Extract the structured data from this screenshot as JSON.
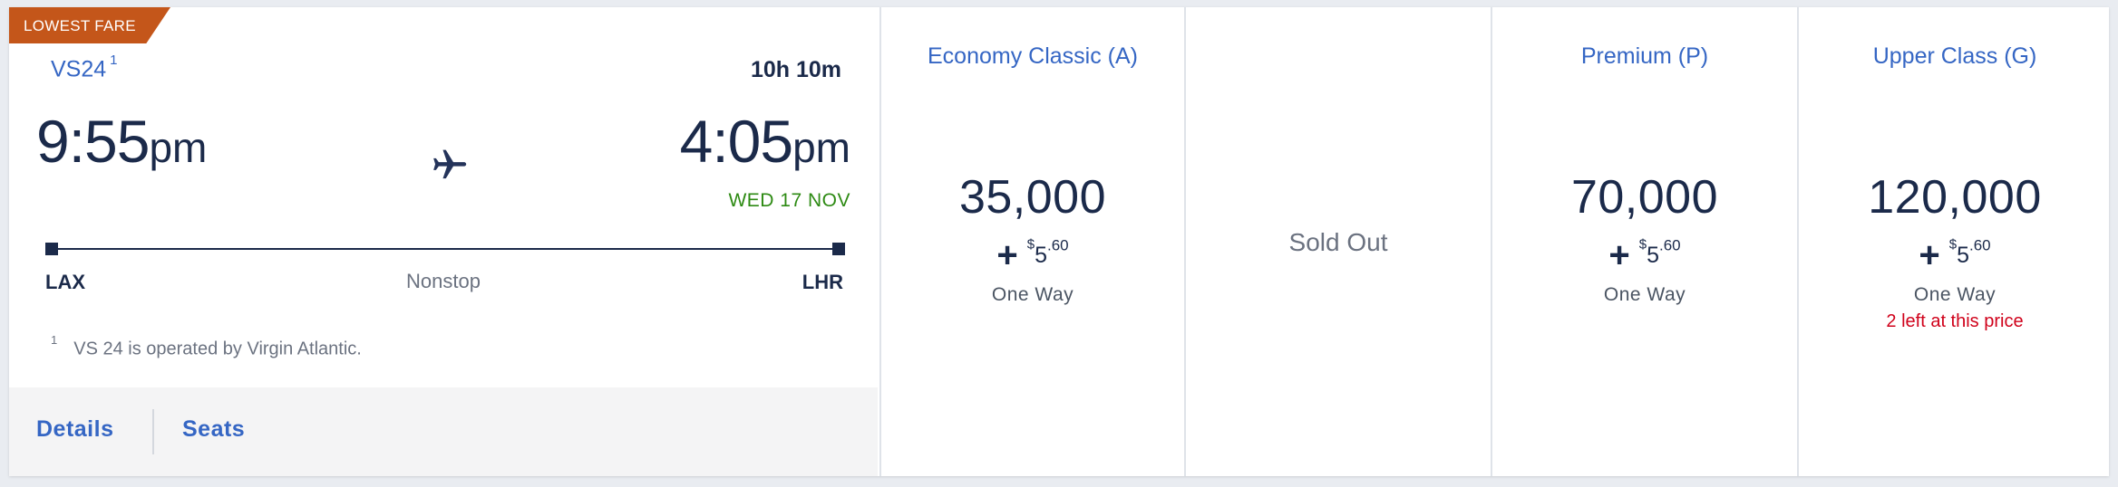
{
  "flight": {
    "badge": "LOWEST FARE",
    "number": "VS24",
    "footnote_marker": "1",
    "duration": "10h 10m",
    "departure": {
      "time": "9:55",
      "ampm": "pm",
      "airport": "LAX"
    },
    "arrival": {
      "time": "4:05",
      "ampm": "pm",
      "date": "WED 17 NOV",
      "airport": "LHR"
    },
    "stops": "Nonstop",
    "footnote": "VS 24 is operated by Virgin Atlantic.",
    "icons": {
      "plane": "airplane-icon"
    }
  },
  "actions": {
    "details": "Details",
    "seats": "Seats"
  },
  "fares": [
    {
      "title": "Economy Classic (A)",
      "miles": "35,000",
      "plus": "+",
      "currency": "$",
      "amount": "5",
      "cents": ".60",
      "trip": "One Way",
      "remaining": ""
    },
    {
      "title": "",
      "status": "Sold Out"
    },
    {
      "title": "Premium (P)",
      "miles": "70,000",
      "plus": "+",
      "currency": "$",
      "amount": "5",
      "cents": ".60",
      "trip": "One Way",
      "remaining": ""
    },
    {
      "title": "Upper Class (G)",
      "miles": "120,000",
      "plus": "+",
      "currency": "$",
      "amount": "5",
      "cents": ".60",
      "trip": "One Way",
      "remaining": "2 left at this price"
    }
  ],
  "colors": {
    "accent": "#3566c4",
    "navy": "#1b2a4a",
    "badge": "#c4561a",
    "arrival_date": "#2d8a13",
    "warning": "#d0021b"
  }
}
